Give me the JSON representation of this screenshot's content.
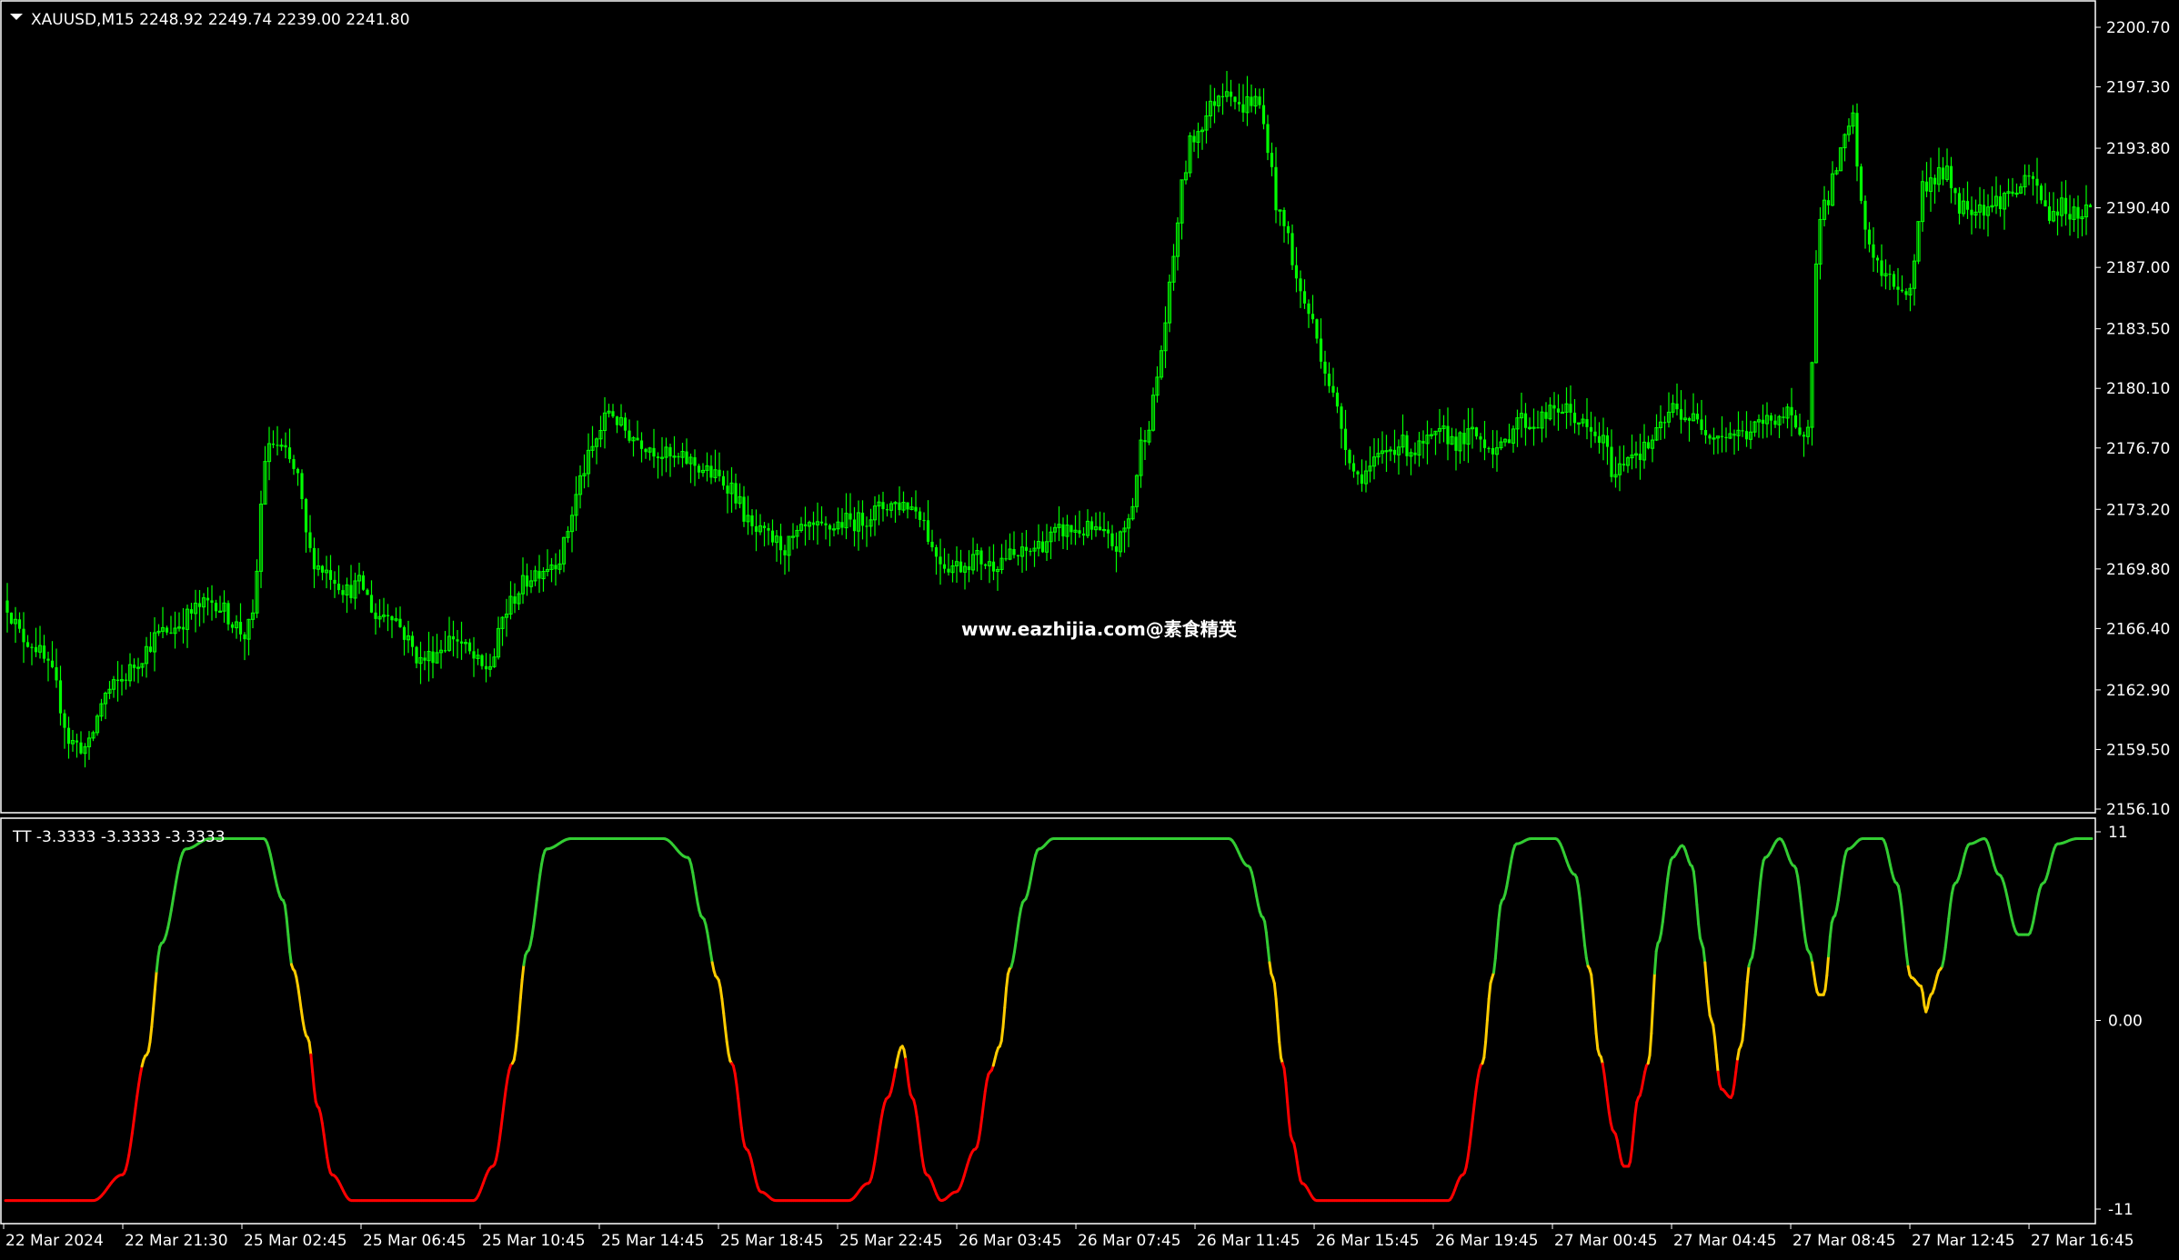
{
  "window": {
    "symbol_header": "XAUUSD,M15  2248.92 2249.74 2239.00 2241.80",
    "indicator_header": "TT -3.3333 -3.3333 -3.3333",
    "watermark": "www.eazhijia.com@素食精英"
  },
  "colors": {
    "background": "#000000",
    "candle": "#00ff00",
    "axis": "#ffffff",
    "osc_up": "#33cc33",
    "osc_mid": "#ffcc00",
    "osc_down": "#ff0000"
  },
  "chart_data": [
    {
      "type": "candlestick",
      "symbol": "XAUUSD",
      "timeframe": "M15",
      "ylim": [
        2156.1,
        2200.7
      ],
      "yticks": [
        "2200.70",
        "2197.30",
        "2193.80",
        "2190.40",
        "2187.00",
        "2183.50",
        "2180.10",
        "2176.70",
        "2173.20",
        "2169.80",
        "2166.40",
        "2162.90",
        "2159.50",
        "2156.10"
      ],
      "close_path": [
        [
          0,
          2168.0
        ],
        [
          6,
          2166.0
        ],
        [
          12,
          2165.5
        ],
        [
          20,
          2163.5
        ],
        [
          26,
          2160.0
        ],
        [
          34,
          2159.5
        ],
        [
          40,
          2162.5
        ],
        [
          48,
          2163.5
        ],
        [
          54,
          2164.5
        ],
        [
          62,
          2166.0
        ],
        [
          70,
          2166.5
        ],
        [
          78,
          2167.5
        ],
        [
          86,
          2168.0
        ],
        [
          92,
          2167.0
        ],
        [
          98,
          2166.0
        ],
        [
          102,
          2167.0
        ],
        [
          106,
          2176.0
        ],
        [
          110,
          2177.0
        ],
        [
          114,
          2176.5
        ],
        [
          120,
          2175.0
        ],
        [
          124,
          2171.0
        ],
        [
          128,
          2170.0
        ],
        [
          134,
          2169.5
        ],
        [
          140,
          2168.5
        ],
        [
          146,
          2169.0
        ],
        [
          152,
          2167.0
        ],
        [
          158,
          2167.5
        ],
        [
          164,
          2166.0
        ],
        [
          170,
          2164.5
        ],
        [
          176,
          2165.0
        ],
        [
          184,
          2166.0
        ],
        [
          190,
          2165.0
        ],
        [
          196,
          2164.0
        ],
        [
          200,
          2164.5
        ],
        [
          204,
          2167.0
        ],
        [
          210,
          2168.5
        ],
        [
          216,
          2169.5
        ],
        [
          222,
          2170.0
        ],
        [
          228,
          2170.5
        ],
        [
          236,
          2175.0
        ],
        [
          242,
          2177.0
        ],
        [
          248,
          2179.0
        ],
        [
          252,
          2178.0
        ],
        [
          256,
          2177.5
        ],
        [
          262,
          2177.0
        ],
        [
          268,
          2176.5
        ],
        [
          274,
          2176.0
        ],
        [
          280,
          2176.0
        ],
        [
          286,
          2175.5
        ],
        [
          292,
          2175.0
        ],
        [
          298,
          2174.5
        ],
        [
          306,
          2172.0
        ],
        [
          314,
          2171.5
        ],
        [
          320,
          2171.0
        ],
        [
          328,
          2172.0
        ],
        [
          336,
          2172.0
        ],
        [
          344,
          2172.5
        ],
        [
          350,
          2172.5
        ],
        [
          356,
          2173.0
        ],
        [
          362,
          2173.5
        ],
        [
          370,
          2173.5
        ],
        [
          376,
          2173.0
        ],
        [
          380,
          2171.0
        ],
        [
          386,
          2170.0
        ],
        [
          392,
          2170.0
        ],
        [
          398,
          2170.5
        ],
        [
          404,
          2170.0
        ],
        [
          410,
          2170.5
        ],
        [
          416,
          2170.5
        ],
        [
          422,
          2171.0
        ],
        [
          428,
          2171.5
        ],
        [
          434,
          2172.0
        ],
        [
          440,
          2172.0
        ],
        [
          446,
          2172.0
        ],
        [
          452,
          2171.5
        ],
        [
          456,
          2171.0
        ],
        [
          462,
          2173.0
        ],
        [
          466,
          2177.0
        ],
        [
          470,
          2178.5
        ],
        [
          474,
          2182.0
        ],
        [
          478,
          2186.0
        ],
        [
          482,
          2191.0
        ],
        [
          486,
          2194.0
        ],
        [
          490,
          2195.0
        ],
        [
          494,
          2196.0
        ],
        [
          498,
          2197.0
        ],
        [
          502,
          2197.5
        ],
        [
          506,
          2196.0
        ],
        [
          510,
          2196.5
        ],
        [
          514,
          2196.5
        ],
        [
          518,
          2194.0
        ],
        [
          522,
          2190.0
        ],
        [
          526,
          2189.0
        ],
        [
          530,
          2186.0
        ],
        [
          536,
          2184.0
        ],
        [
          542,
          2181.0
        ],
        [
          548,
          2178.0
        ],
        [
          554,
          2175.0
        ],
        [
          560,
          2175.5
        ],
        [
          566,
          2176.5
        ],
        [
          572,
          2177.0
        ],
        [
          578,
          2176.5
        ],
        [
          584,
          2177.0
        ],
        [
          590,
          2177.5
        ],
        [
          596,
          2177.0
        ],
        [
          602,
          2177.5
        ],
        [
          608,
          2177.0
        ],
        [
          614,
          2176.5
        ],
        [
          620,
          2178.5
        ],
        [
          626,
          2178.0
        ],
        [
          632,
          2178.5
        ],
        [
          638,
          2179.0
        ],
        [
          644,
          2178.5
        ],
        [
          650,
          2177.5
        ],
        [
          656,
          2177.0
        ],
        [
          660,
          2175.0
        ],
        [
          666,
          2176.5
        ],
        [
          672,
          2176.5
        ],
        [
          678,
          2177.5
        ],
        [
          684,
          2179.0
        ],
        [
          690,
          2178.5
        ],
        [
          696,
          2178.0
        ],
        [
          702,
          2177.5
        ],
        [
          708,
          2177.5
        ],
        [
          714,
          2177.5
        ],
        [
          720,
          2178.0
        ],
        [
          726,
          2178.5
        ],
        [
          732,
          2178.5
        ],
        [
          736,
          2177.0
        ],
        [
          740,
          2178.5
        ],
        [
          744,
          2190.0
        ],
        [
          748,
          2191.0
        ],
        [
          752,
          2193.0
        ],
        [
          758,
          2195.5
        ],
        [
          762,
          2189.5
        ],
        [
          766,
          2188.0
        ],
        [
          770,
          2186.5
        ],
        [
          776,
          2186.0
        ],
        [
          782,
          2185.5
        ],
        [
          786,
          2191.5
        ],
        [
          790,
          2192.0
        ],
        [
          796,
          2192.5
        ],
        [
          802,
          2190.5
        ],
        [
          808,
          2190.5
        ],
        [
          814,
          2190.5
        ],
        [
          820,
          2191.0
        ],
        [
          826,
          2191.5
        ],
        [
          832,
          2192.0
        ],
        [
          838,
          2190.0
        ],
        [
          844,
          2190.5
        ],
        [
          850,
          2190.0
        ],
        [
          856,
          2190.5
        ]
      ]
    },
    {
      "type": "line",
      "indicator": "TT",
      "ylim": [
        -11,
        11
      ],
      "yticks": [
        "11",
        "0.00",
        "-11"
      ],
      "points": [
        [
          0,
          -10.5
        ],
        [
          12,
          -10.5
        ],
        [
          36,
          -10.5
        ],
        [
          48,
          -9
        ],
        [
          58,
          -2
        ],
        [
          64,
          4.5
        ],
        [
          74,
          10
        ],
        [
          84,
          10.6
        ],
        [
          96,
          10.6
        ],
        [
          106,
          10.6
        ],
        [
          114,
          7
        ],
        [
          118,
          3
        ],
        [
          124,
          -1
        ],
        [
          128,
          -5
        ],
        [
          134,
          -9
        ],
        [
          142,
          -10.5
        ],
        [
          192,
          -10.5
        ],
        [
          200,
          -8.5
        ],
        [
          208,
          -2.5
        ],
        [
          214,
          4
        ],
        [
          222,
          10
        ],
        [
          232,
          10.6
        ],
        [
          270,
          10.6
        ],
        [
          280,
          9.5
        ],
        [
          286,
          6
        ],
        [
          292,
          2.5
        ],
        [
          298,
          -2.5
        ],
        [
          304,
          -7.5
        ],
        [
          310,
          -10
        ],
        [
          316,
          -10.5
        ],
        [
          346,
          -10.5
        ],
        [
          354,
          -9.5
        ],
        [
          362,
          -4.5
        ],
        [
          368,
          -1.5
        ],
        [
          372,
          -4.5
        ],
        [
          378,
          -9
        ],
        [
          384,
          -10.5
        ],
        [
          390,
          -10
        ],
        [
          398,
          -7.5
        ],
        [
          404,
          -3
        ],
        [
          408,
          -1.5
        ],
        [
          412,
          3
        ],
        [
          418,
          7
        ],
        [
          424,
          10
        ],
        [
          430,
          10.6
        ],
        [
          494,
          10.6
        ],
        [
          502,
          10.6
        ],
        [
          510,
          9
        ],
        [
          516,
          6
        ],
        [
          520,
          2.5
        ],
        [
          524,
          -2.5
        ],
        [
          528,
          -7
        ],
        [
          532,
          -9.5
        ],
        [
          538,
          -10.5
        ],
        [
          592,
          -10.5
        ],
        [
          598,
          -9
        ],
        [
          606,
          -2.5
        ],
        [
          610,
          2.5
        ],
        [
          614,
          7
        ],
        [
          620,
          10.3
        ],
        [
          626,
          10.6
        ],
        [
          636,
          10.6
        ],
        [
          644,
          8.5
        ],
        [
          650,
          3
        ],
        [
          654,
          -2
        ],
        [
          660,
          -6.5
        ],
        [
          664,
          -8.5
        ],
        [
          666,
          -8.5
        ],
        [
          670,
          -4.5
        ],
        [
          674,
          -2.5
        ],
        [
          678,
          4.5
        ],
        [
          684,
          9.5
        ],
        [
          688,
          10.2
        ],
        [
          692,
          9
        ],
        [
          696,
          4.5
        ],
        [
          700,
          0
        ],
        [
          704,
          -4
        ],
        [
          708,
          -4.5
        ],
        [
          712,
          -1.5
        ],
        [
          716,
          3.5
        ],
        [
          722,
          9.5
        ],
        [
          728,
          10.6
        ],
        [
          734,
          9
        ],
        [
          740,
          4
        ],
        [
          744,
          1.5
        ],
        [
          746,
          1.5
        ],
        [
          750,
          6
        ],
        [
          756,
          10
        ],
        [
          762,
          10.6
        ],
        [
          770,
          10.6
        ],
        [
          776,
          8
        ],
        [
          782,
          2.5
        ],
        [
          786,
          2
        ],
        [
          788,
          0.5
        ],
        [
          790,
          1.5
        ],
        [
          794,
          3
        ],
        [
          800,
          8
        ],
        [
          806,
          10.3
        ],
        [
          812,
          10.6
        ],
        [
          818,
          8.5
        ],
        [
          826,
          5
        ],
        [
          830,
          5
        ],
        [
          836,
          8
        ],
        [
          842,
          10.3
        ],
        [
          850,
          10.6
        ],
        [
          856,
          10.6
        ]
      ]
    }
  ],
  "time_axis": [
    "22 Mar 2024",
    "22 Mar 21:30",
    "25 Mar 02:45",
    "25 Mar 06:45",
    "25 Mar 10:45",
    "25 Mar 14:45",
    "25 Mar 18:45",
    "25 Mar 22:45",
    "26 Mar 03:45",
    "26 Mar 07:45",
    "26 Mar 11:45",
    "26 Mar 15:45",
    "26 Mar 19:45",
    "27 Mar 00:45",
    "27 Mar 04:45",
    "27 Mar 08:45",
    "27 Mar 12:45",
    "27 Mar 16:45"
  ]
}
